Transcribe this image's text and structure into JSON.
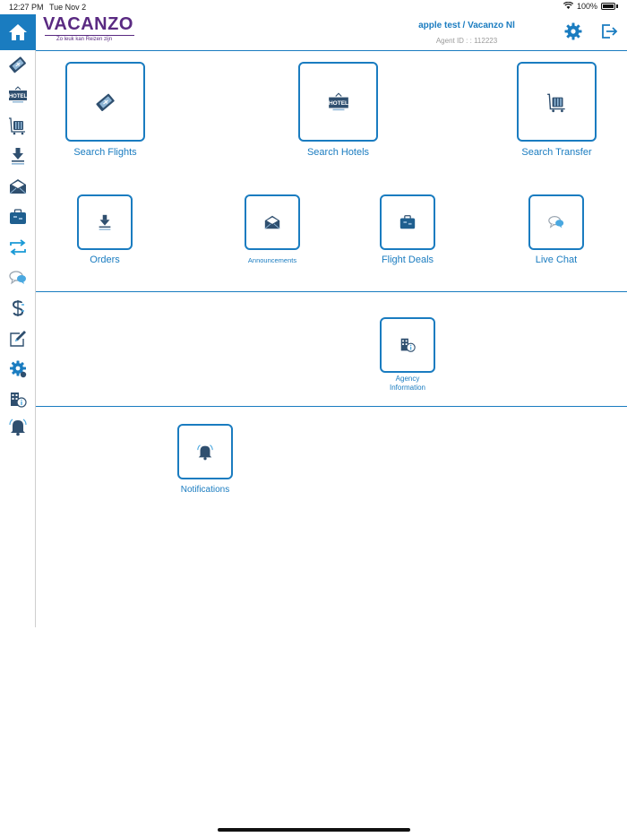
{
  "status_bar": {
    "time": "12:27 PM",
    "date": "Tue Nov 2",
    "battery": "100%"
  },
  "header": {
    "brand": "VACANZO",
    "tagline": "Zo leuk kan Reizen zijn",
    "agent_name": "apple test / Vacanzo Nl",
    "agent_id": "Agent ID : : 112223"
  },
  "colors": {
    "accent": "#1a7cc0",
    "brand": "#5a2a82",
    "icon_dark": "#2f4f6f"
  },
  "sidebar": {
    "items": [
      {
        "icon": "flights-icon"
      },
      {
        "icon": "hotel-icon"
      },
      {
        "icon": "transfer-luggage-icon"
      },
      {
        "icon": "orders-download-icon"
      },
      {
        "icon": "announcements-envelope-icon"
      },
      {
        "icon": "flight-deals-briefcase-icon"
      },
      {
        "icon": "exchange-arrows-icon"
      },
      {
        "icon": "live-chat-icon"
      },
      {
        "icon": "dollar-icon"
      },
      {
        "icon": "edit-icon"
      },
      {
        "icon": "settings-gear-icon"
      },
      {
        "icon": "agency-info-icon"
      },
      {
        "icon": "notifications-bell-icon"
      }
    ]
  },
  "tiles": {
    "search_flights": "Search Flights",
    "search_hotels": "Search Hotels",
    "search_transfer": "Search Transfer",
    "orders": "Orders",
    "announcements": "Announcements",
    "flight_deals": "Flight Deals",
    "live_chat": "Live Chat",
    "agency_information": "Agency\nInformation",
    "notifications": "Notifications"
  },
  "icon_text": {
    "hotel": "HOTEL"
  }
}
